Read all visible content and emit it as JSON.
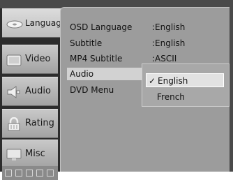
{
  "tabs": [
    {
      "label": "Language",
      "icon": "disc-icon",
      "active": true
    },
    {
      "label": "Video",
      "icon": "monitor-icon",
      "active": false
    },
    {
      "label": "Audio",
      "icon": "speaker-icon",
      "active": false
    },
    {
      "label": "Rating",
      "icon": "lock-icon",
      "active": false
    },
    {
      "label": "Misc",
      "icon": "screen-icon",
      "active": false
    }
  ],
  "settings": [
    {
      "label": "OSD Language",
      "value": ":English"
    },
    {
      "label": "Subtitle",
      "value": ":English"
    },
    {
      "label": "MP4 Subtitle",
      "value": ":ASCII"
    },
    {
      "label": "Audio",
      "value": ""
    },
    {
      "label": "DVD Menu",
      "value": ""
    }
  ],
  "audio_dropdown": {
    "options": [
      {
        "label": "English",
        "selected": true,
        "check": "✓"
      },
      {
        "label": "French",
        "selected": false,
        "check": ""
      }
    ]
  },
  "colors": {
    "background": "#4a4a4a",
    "panel": "#9c9c9c",
    "tab": "#b4b4b4",
    "highlight": "#d2d2d2"
  }
}
